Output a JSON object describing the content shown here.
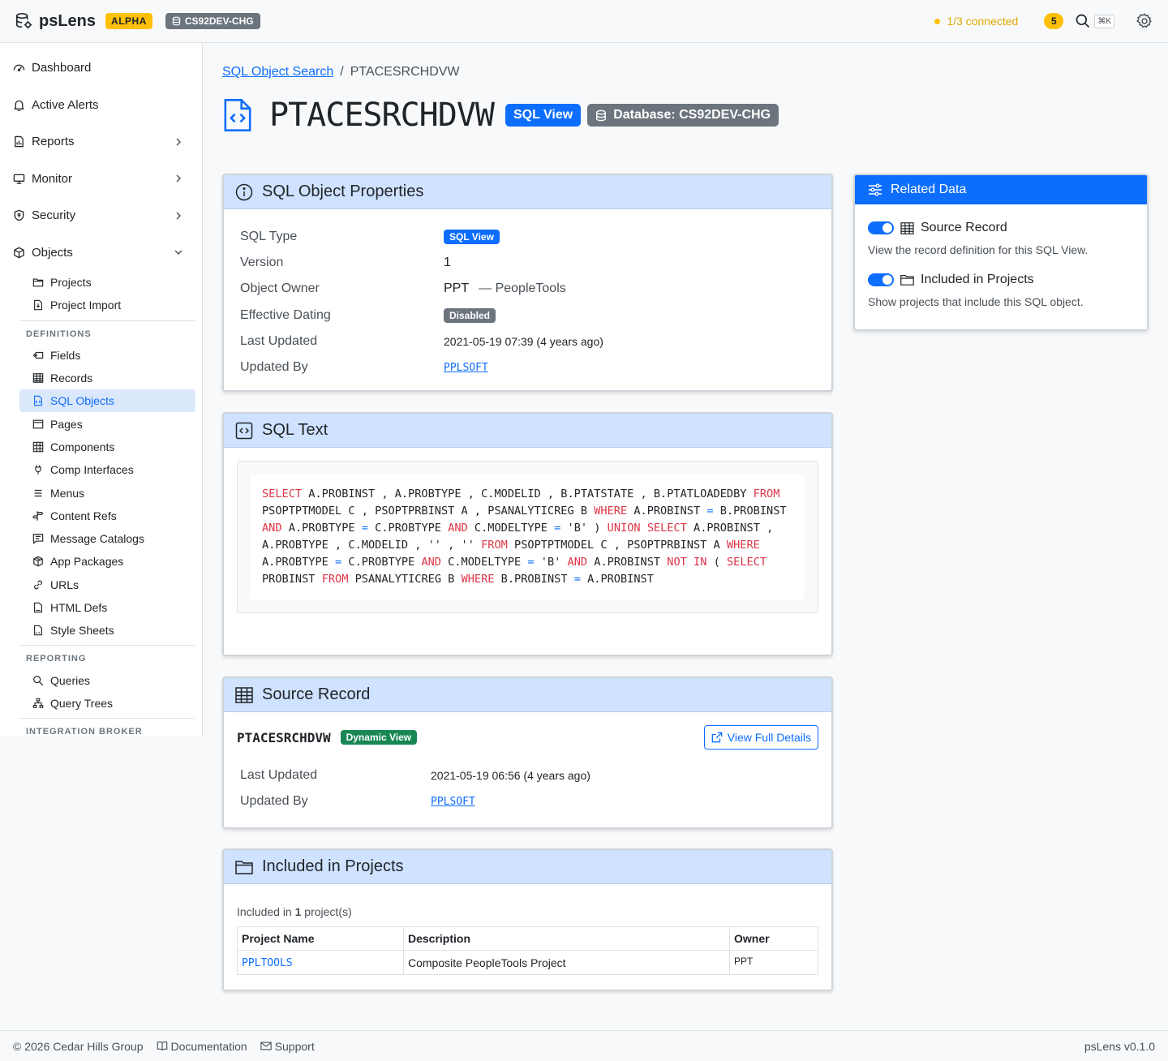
{
  "header": {
    "app_name": "psLens",
    "alpha_label": "ALPHA",
    "db_label": "CS92DEV-CHG",
    "connection_status": "1/3 connected",
    "notification_count": "5",
    "shortcut": "⌘K",
    "status_color": "#ffc107"
  },
  "sidebar": {
    "top_items": [
      {
        "label": "Dashboard",
        "icon": "dashboard-icon"
      },
      {
        "label": "Active Alerts",
        "icon": "bell-icon"
      },
      {
        "label": "Reports",
        "icon": "chart-icon"
      },
      {
        "label": "Monitor",
        "icon": "monitor-icon"
      },
      {
        "label": "Security",
        "icon": "shield-icon"
      },
      {
        "label": "Objects",
        "icon": "box-icon"
      }
    ],
    "objects_items": [
      {
        "label": "Projects",
        "icon": "folder-icon"
      },
      {
        "label": "Project Import",
        "icon": "file-import-icon"
      }
    ],
    "definitions_head": "DEFINITIONS",
    "definitions": [
      {
        "label": "Fields",
        "icon": "tag-icon"
      },
      {
        "label": "Records",
        "icon": "table-icon"
      },
      {
        "label": "SQL Objects",
        "icon": "file-code-icon"
      },
      {
        "label": "Pages",
        "icon": "window-icon"
      },
      {
        "label": "Components",
        "icon": "grid-icon"
      },
      {
        "label": "Comp Interfaces",
        "icon": "plug-icon"
      },
      {
        "label": "Menus",
        "icon": "list-icon"
      },
      {
        "label": "Content Refs",
        "icon": "signpost-icon"
      },
      {
        "label": "Message Catalogs",
        "icon": "message-icon"
      },
      {
        "label": "App Packages",
        "icon": "package-icon"
      },
      {
        "label": "URLs",
        "icon": "link-icon"
      },
      {
        "label": "HTML Defs",
        "icon": "file-html-icon"
      },
      {
        "label": "Style Sheets",
        "icon": "file-css-icon"
      }
    ],
    "reporting_head": "REPORTING",
    "reporting": [
      {
        "label": "Queries",
        "icon": "search-icon"
      },
      {
        "label": "Query Trees",
        "icon": "tree-icon"
      }
    ],
    "integration_head": "INTEGRATION BROKER"
  },
  "breadcrumb": {
    "parent": "SQL Object Search",
    "sep": "/",
    "current": "PTACESRCHDVW"
  },
  "page": {
    "title": "PTACESRCHDVW",
    "type_badge": "SQL View",
    "db_badge": "Database: CS92DEV-CHG"
  },
  "properties": {
    "title": "SQL Object Properties",
    "rows": {
      "sql_type_label": "SQL Type",
      "sql_type_value": "SQL View",
      "version_label": "Version",
      "version_value": "1",
      "owner_label": "Object Owner",
      "owner_value": "PPT",
      "owner_desc": "— PeopleTools",
      "eff_label": "Effective Dating",
      "eff_value": "Disabled",
      "updated_label": "Last Updated",
      "updated_value": "2021-05-19 07:39 (4 years ago)",
      "by_label": "Updated By",
      "by_value": "PPLSOFT"
    }
  },
  "sql_text": {
    "title": "SQL Text",
    "tokens": [
      [
        "kw",
        "SELECT"
      ],
      [
        "t",
        " A.PROBINST , A.PROBTYPE , C.MODELID , B.PTATSTATE , B.PTATLOADEDBY "
      ],
      [
        "kw",
        "FROM"
      ],
      [
        "t",
        " PSOPTPTMODEL C , PSOPTPRBINST A , PSANALYTICREG B "
      ],
      [
        "kw",
        "WHERE"
      ],
      [
        "t",
        " A.PROBINST "
      ],
      [
        "op",
        "="
      ],
      [
        "t",
        " B.PROBINST "
      ],
      [
        "kw",
        "AND"
      ],
      [
        "t",
        " A.PROBTYPE "
      ],
      [
        "op",
        "="
      ],
      [
        "t",
        " C.PROBTYPE "
      ],
      [
        "kw",
        "AND"
      ],
      [
        "t",
        " C.MODELTYPE "
      ],
      [
        "op",
        "="
      ],
      [
        "t",
        " 'B' ) "
      ],
      [
        "kw",
        "UNION"
      ],
      [
        "t",
        " "
      ],
      [
        "kw",
        "SELECT"
      ],
      [
        "t",
        " A.PROBINST , A.PROBTYPE , C.MODELID , '' , '' "
      ],
      [
        "kw",
        "FROM"
      ],
      [
        "t",
        " PSOPTPTMODEL C , PSOPTPRBINST A "
      ],
      [
        "kw",
        "WHERE"
      ],
      [
        "t",
        " A.PROBTYPE "
      ],
      [
        "op",
        "="
      ],
      [
        "t",
        " C.PROBTYPE "
      ],
      [
        "kw",
        "AND"
      ],
      [
        "t",
        " C.MODELTYPE "
      ],
      [
        "op",
        "="
      ],
      [
        "t",
        " 'B' "
      ],
      [
        "kw",
        "AND"
      ],
      [
        "t",
        " A.PROBINST "
      ],
      [
        "kw",
        "NOT"
      ],
      [
        "t",
        " "
      ],
      [
        "kw",
        "IN"
      ],
      [
        "t",
        " ( "
      ],
      [
        "kw",
        "SELECT"
      ],
      [
        "t",
        " PROBINST "
      ],
      [
        "kw",
        "FROM"
      ],
      [
        "t",
        " PSANALYTICREG B "
      ],
      [
        "kw",
        "WHERE"
      ],
      [
        "t",
        " B.PROBINST "
      ],
      [
        "op",
        "="
      ],
      [
        "t",
        " A.PROBINST"
      ]
    ]
  },
  "source_record": {
    "title": "Source Record",
    "name": "PTACESRCHDVW",
    "badge": "Dynamic View",
    "view_button": "View Full Details",
    "updated_label": "Last Updated",
    "updated_value": "2021-05-19 06:56 (4 years ago)",
    "by_label": "Updated By",
    "by_value": "PPLSOFT"
  },
  "projects": {
    "title": "Included in Projects",
    "summary_prefix": "Included in ",
    "summary_count": "1",
    "summary_suffix": " project(s)",
    "columns": [
      "Project Name",
      "Description",
      "Owner"
    ],
    "rows": [
      {
        "name": "PPLTOOLS",
        "description": "Composite PeopleTools Project",
        "owner": "PPT"
      }
    ]
  },
  "related": {
    "title": "Related Data",
    "items": [
      {
        "label": "Source Record",
        "desc": "View the record definition for this SQL View."
      },
      {
        "label": "Included in Projects",
        "desc": "Show projects that include this SQL object."
      }
    ]
  },
  "footer": {
    "copyright": "© 2026 Cedar Hills Group",
    "docs": "Documentation",
    "support": "Support",
    "version": "psLens v0.1.0"
  }
}
